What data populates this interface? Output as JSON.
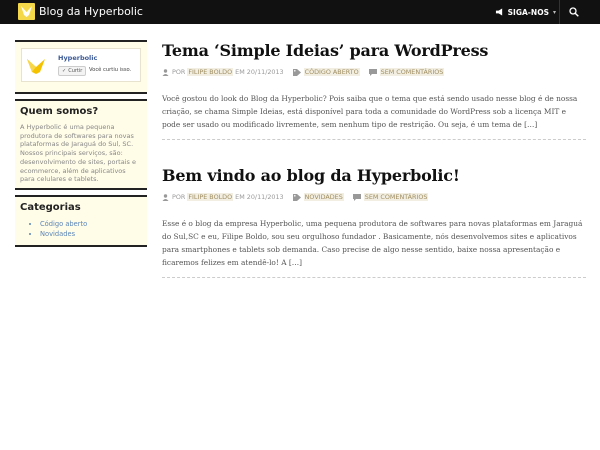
{
  "topbar": {
    "site_title": "Blog da Hyperbolic",
    "follow_label": "SIGA-NOS",
    "colors": {
      "bar": "#111111",
      "logo": "#f5d84a"
    }
  },
  "sidebar": {
    "facebook": {
      "page_name": "Hyperbolic",
      "like_button": "Curtir",
      "like_text": "Você curtiu isso."
    },
    "about": {
      "title": "Quem somos?",
      "text": "A Hyperbolic é uma pequena produtora de softwares para novas plataformas de Jaraguá do Sul, SC. Nossos principais serviços, são: desenvolvimento de sites, portais e ecommerce, além de aplicativos para celulares e tablets."
    },
    "categories": {
      "title": "Categorias",
      "items": [
        "Código aberto",
        "Novidades"
      ]
    }
  },
  "posts": [
    {
      "title": "Tema ‘Simple Ideias’ para WordPress",
      "by": "POR",
      "author": "FILIPE BOLDO",
      "date_prefix": "EM",
      "date": "20/11/2013",
      "category": "CÓDIGO ABERTO",
      "comments": "SEM COMENTÁRIOS",
      "excerpt": "Você gostou do look do Blog da Hyperbolic? Pois saiba que o tema que está sendo usado nesse blog é de nossa criação, se chama Simple Ideias, está disponível para toda a comunidade do WordPress sob a licença MIT e pode ser usado ou modificado livremente, sem  nenhum tipo de restrição. Ou seja, é um tema de […]"
    },
    {
      "title": "Bem vindo ao blog da Hyperbolic!",
      "by": "POR",
      "author": "FILIPE BOLDO",
      "date_prefix": "EM",
      "date": "20/11/2013",
      "category": "NOVIDADES",
      "comments": "SEM COMENTÁRIOS",
      "excerpt": "Esse é o blog da empresa Hyperbolic, uma pequena produtora de softwares para novas plataformas em Jaraguá do Sul,SC e eu, Filipe Boldo, sou seu orgulhoso fundador . Basicamente, nós desenvolvemos sites e aplicativos para smartphones e tablets sob demanda. Caso precise de algo nesse sentido, baixe nossa apresentação e ficaremos felizes em atendê-lo! A […]"
    }
  ],
  "icons": [
    "logo-icon",
    "megaphone-icon",
    "chevron-down-icon",
    "search-icon",
    "user-icon",
    "tag-icon",
    "comment-icon"
  ]
}
